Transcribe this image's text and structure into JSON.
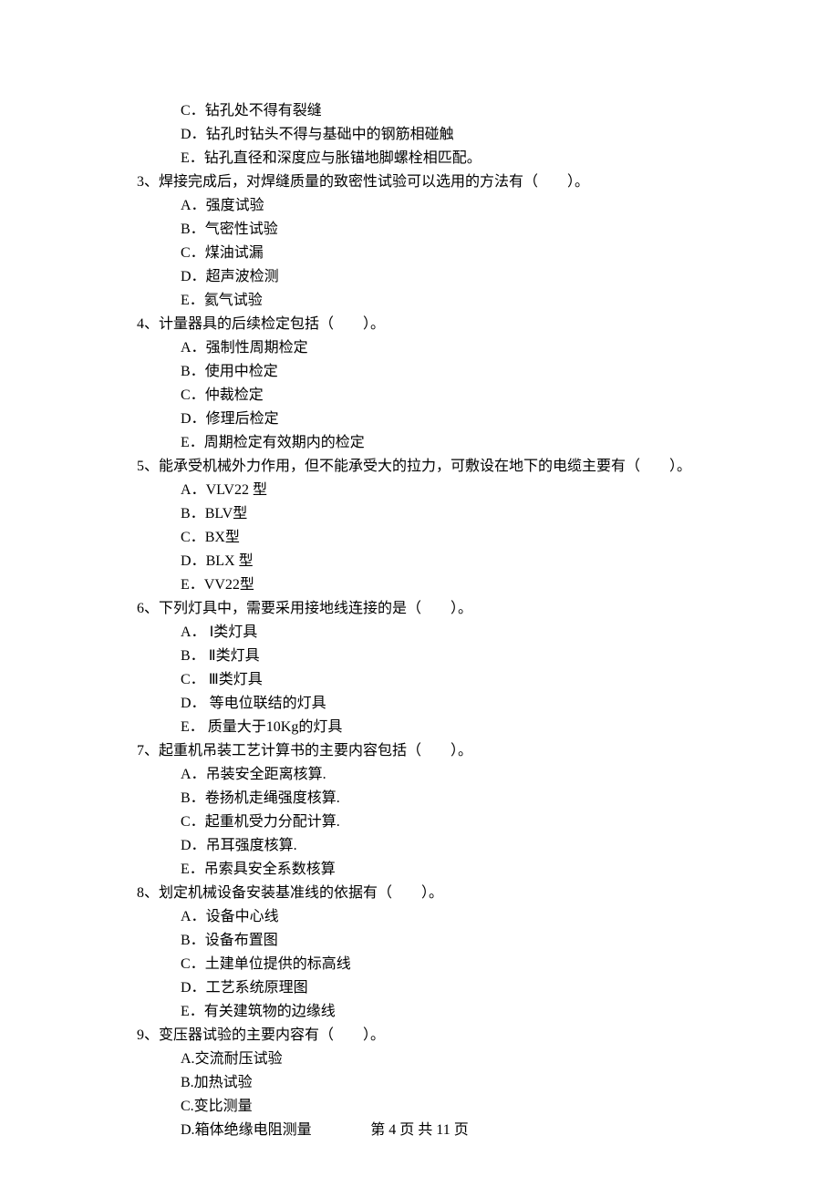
{
  "prefixOptions": [
    {
      "label": "C．",
      "text": "钻孔处不得有裂缝"
    },
    {
      "label": "D．",
      "text": "钻孔时钻头不得与基础中的钢筋相碰触"
    },
    {
      "label": "E．",
      "text": "钻孔直径和深度应与胀锚地脚螺栓相匹配。"
    }
  ],
  "questions": [
    {
      "num": "3、",
      "stem": "焊接完成后，对焊缝质量的致密性试验可以选用的方法有（　　）。",
      "options": [
        {
          "label": "A．",
          "text": "强度试验"
        },
        {
          "label": "B．",
          "text": "气密性试验"
        },
        {
          "label": "C．",
          "text": "煤油试漏"
        },
        {
          "label": "D．",
          "text": "超声波检测"
        },
        {
          "label": "E．",
          "text": "氦气试验"
        }
      ]
    },
    {
      "num": "4、",
      "stem": "计量器具的后续检定包括（　　）。",
      "options": [
        {
          "label": "A．",
          "text": "强制性周期检定"
        },
        {
          "label": "B．",
          "text": "使用中检定"
        },
        {
          "label": "C．",
          "text": "仲裁检定"
        },
        {
          "label": "D．",
          "text": "修理后检定"
        },
        {
          "label": "E．",
          "text": "周期检定有效期内的检定"
        }
      ]
    },
    {
      "num": "5、",
      "stem": "能承受机械外力作用，但不能承受大的拉力，可敷设在地下的电缆主要有（　　）。",
      "options": [
        {
          "label": "A．",
          "text": "VLV22 型"
        },
        {
          "label": "B．",
          "text": "BLV型"
        },
        {
          "label": "C．",
          "text": "BX型"
        },
        {
          "label": "D．",
          "text": "BLX 型"
        },
        {
          "label": "E．",
          "text": "VV22型"
        }
      ]
    },
    {
      "num": "6、",
      "stem": "下列灯具中，需要采用接地线连接的是（　　）。",
      "options": [
        {
          "label": "A．",
          "text": " Ⅰ类灯具"
        },
        {
          "label": "B．",
          "text": " Ⅱ类灯具"
        },
        {
          "label": "C．",
          "text": " Ⅲ类灯具"
        },
        {
          "label": "D．",
          "text": " 等电位联结的灯具"
        },
        {
          "label": "E．",
          "text": " 质量大于10Kg的灯具"
        }
      ]
    },
    {
      "num": "7、",
      "stem": "起重机吊装工艺计算书的主要内容包括（　　）。",
      "options": [
        {
          "label": "A．",
          "text": "吊装安全距离核算."
        },
        {
          "label": "B．",
          "text": "卷扬机走绳强度核算."
        },
        {
          "label": "C．",
          "text": "起重机受力分配计算."
        },
        {
          "label": "D．",
          "text": "吊耳强度核算."
        },
        {
          "label": "E．",
          "text": "吊索具安全系数核算"
        }
      ]
    },
    {
      "num": "8、",
      "stem": "划定机械设备安装基准线的依据有（　　）。",
      "options": [
        {
          "label": "A．",
          "text": "设备中心线"
        },
        {
          "label": "B．",
          "text": "设备布置图"
        },
        {
          "label": "C．",
          "text": "土建单位提供的标高线"
        },
        {
          "label": "D．",
          "text": "工艺系统原理图"
        },
        {
          "label": "E．",
          "text": "有关建筑物的边缘线"
        }
      ]
    },
    {
      "num": "9、",
      "stem": "变压器试验的主要内容有（　　）。",
      "options": [
        {
          "label": "A.",
          "text": "交流耐压试验"
        },
        {
          "label": "B.",
          "text": "加热试验"
        },
        {
          "label": "C.",
          "text": "变比测量"
        },
        {
          "label": "D.",
          "text": "箱体绝缘电阻测量"
        }
      ]
    }
  ],
  "footer": "第 4 页 共 11 页"
}
